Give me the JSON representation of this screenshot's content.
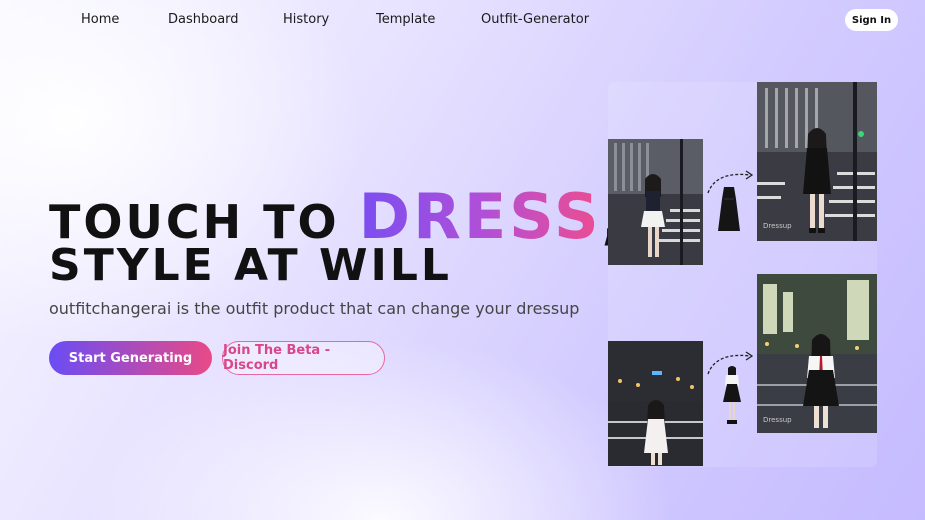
{
  "nav": {
    "items": [
      "Home",
      "Dashboard",
      "History",
      "Template",
      "Outfit-Generator"
    ],
    "signin_label": "Sign In"
  },
  "hero": {
    "line1_prefix": "TOUCH TO ",
    "line1_accent": "DRESS",
    "line1_suffix": ",",
    "line2": "STYLE AT WILL",
    "subtitle": "outfitchangerai is the outfit product that can change your dressup",
    "primary_button": "Start Generating",
    "secondary_button": "Join The Beta - Discord"
  },
  "showcase": {
    "watermark": "Dressup"
  },
  "colors": {
    "accent_start": "#7a4ef0",
    "accent_end": "#ee4d8f",
    "secondary_text": "#d9468a"
  }
}
